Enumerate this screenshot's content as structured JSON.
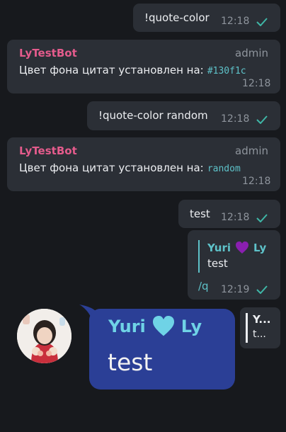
{
  "messages": {
    "m1": {
      "text": "!quote-color",
      "time": "12:18"
    },
    "m2": {
      "sender": "LyTestBot",
      "role": "admin",
      "text": "Цвет фона цитат установлен на:",
      "value": "#130f1c",
      "time": "12:18"
    },
    "m3": {
      "text": "!quote-color random",
      "time": "12:18"
    },
    "m4": {
      "sender": "LyTestBot",
      "role": "admin",
      "text": "Цвет фона цитат установлен на:",
      "value": "random",
      "time": "12:18"
    },
    "m5": {
      "text": "test",
      "time": "12:18"
    },
    "m6": {
      "reply_name": "Yuri",
      "reply_name_end": "Ly",
      "reply_text": "test",
      "text": "/q",
      "time": "12:19"
    }
  },
  "sticker": {
    "name": "Yuri",
    "name_end": "Ly",
    "text": "test",
    "mini_name": "Y...",
    "mini_text": "t..."
  },
  "colors": {
    "background": "#17191d",
    "bubble": "#2b2f36",
    "sender": "#e45b8c",
    "accent": "#5ec2c9",
    "sticker_bg": "#2b3f96",
    "sticker_name": "#6fd3e6",
    "heart_purple": "#8a1fb0"
  },
  "icons": {
    "read": "double-check-icon",
    "heart1": "purple-heart-icon",
    "heart2": "cyan-heart-icon"
  }
}
